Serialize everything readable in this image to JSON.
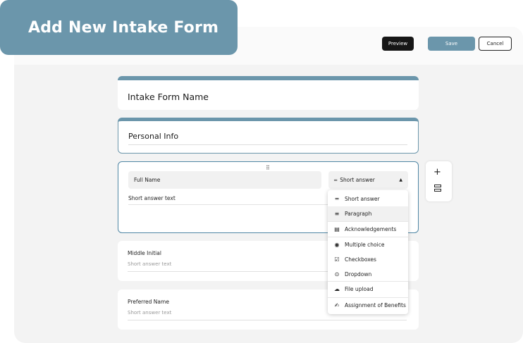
{
  "banner": {
    "title": "Add New Intake Form"
  },
  "toolbar": {
    "preview_label": "Preview",
    "save_label": "Save",
    "cancel_label": "Cancel"
  },
  "form": {
    "name_placeholder": "Intake Form Name",
    "section_title": "Personal Info",
    "active_question": {
      "title": "Full Name",
      "type": "Short answer",
      "hint": "Short answer text"
    },
    "questions": [
      {
        "label": "Middle Initial",
        "hint": "Short answer text"
      },
      {
        "label": "Preferred Name",
        "hint": "Short answer text"
      }
    ]
  },
  "type_menu": {
    "items": [
      {
        "label": "Short answer",
        "icon": "short-answer-icon"
      },
      {
        "label": "Paragraph",
        "icon": "paragraph-icon"
      },
      {
        "label": "Acknowledgements",
        "icon": "acknowledgement-icon"
      },
      {
        "label": "Multiple choice",
        "icon": "radio-icon"
      },
      {
        "label": "Checkboxes",
        "icon": "checkbox-icon"
      },
      {
        "label": "Dropdown",
        "icon": "dropdown-icon"
      },
      {
        "label": "File upload",
        "icon": "upload-icon"
      },
      {
        "label": "Assignment of Benefits",
        "icon": "signature-icon"
      }
    ],
    "highlighted": "Paragraph"
  },
  "colors": {
    "accent": "#6b96ab",
    "dark_button": "#161616"
  }
}
